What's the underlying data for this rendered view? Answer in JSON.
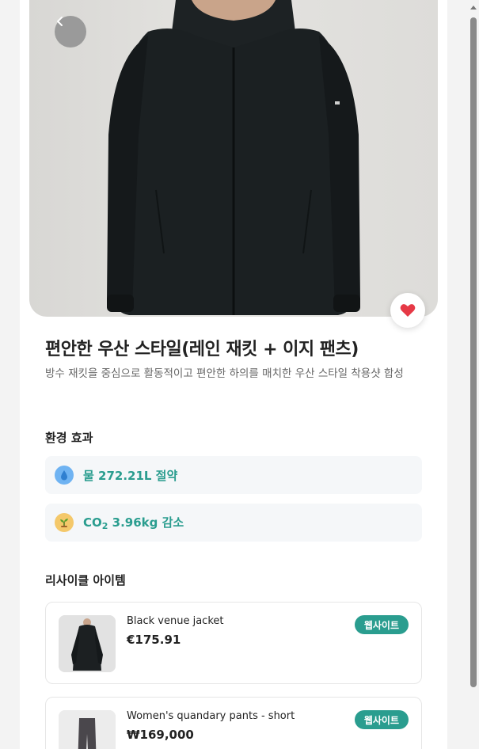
{
  "product": {
    "title": "편안한 우산 스타일(레인 재킷 + 이지 팬츠)",
    "description": "방수 재킷을 중심으로 활동적이고 편안한 하의를 매치한 우산 스타일 착용샷 합성"
  },
  "environment": {
    "section_title": "환경 효과",
    "water": {
      "icon": "water-drop-icon",
      "text": "물 272.21L 절약"
    },
    "co2": {
      "icon": "sprout-icon",
      "prefix": "CO",
      "sub": "2",
      "text": " 3.96kg 감소"
    }
  },
  "recycle": {
    "section_title": "리사이클 아이템",
    "items": [
      {
        "name": "Black venue jacket",
        "price": "€175.91",
        "button": "웹사이트"
      },
      {
        "name": "Women's quandary pants - short",
        "price": "₩169,000",
        "button": "웹사이트"
      }
    ]
  },
  "colors": {
    "accent": "#2a9d8f",
    "heart": "#e63946",
    "water_icon": "#6fb3f2",
    "sprout_icon": "#f4c86a"
  }
}
